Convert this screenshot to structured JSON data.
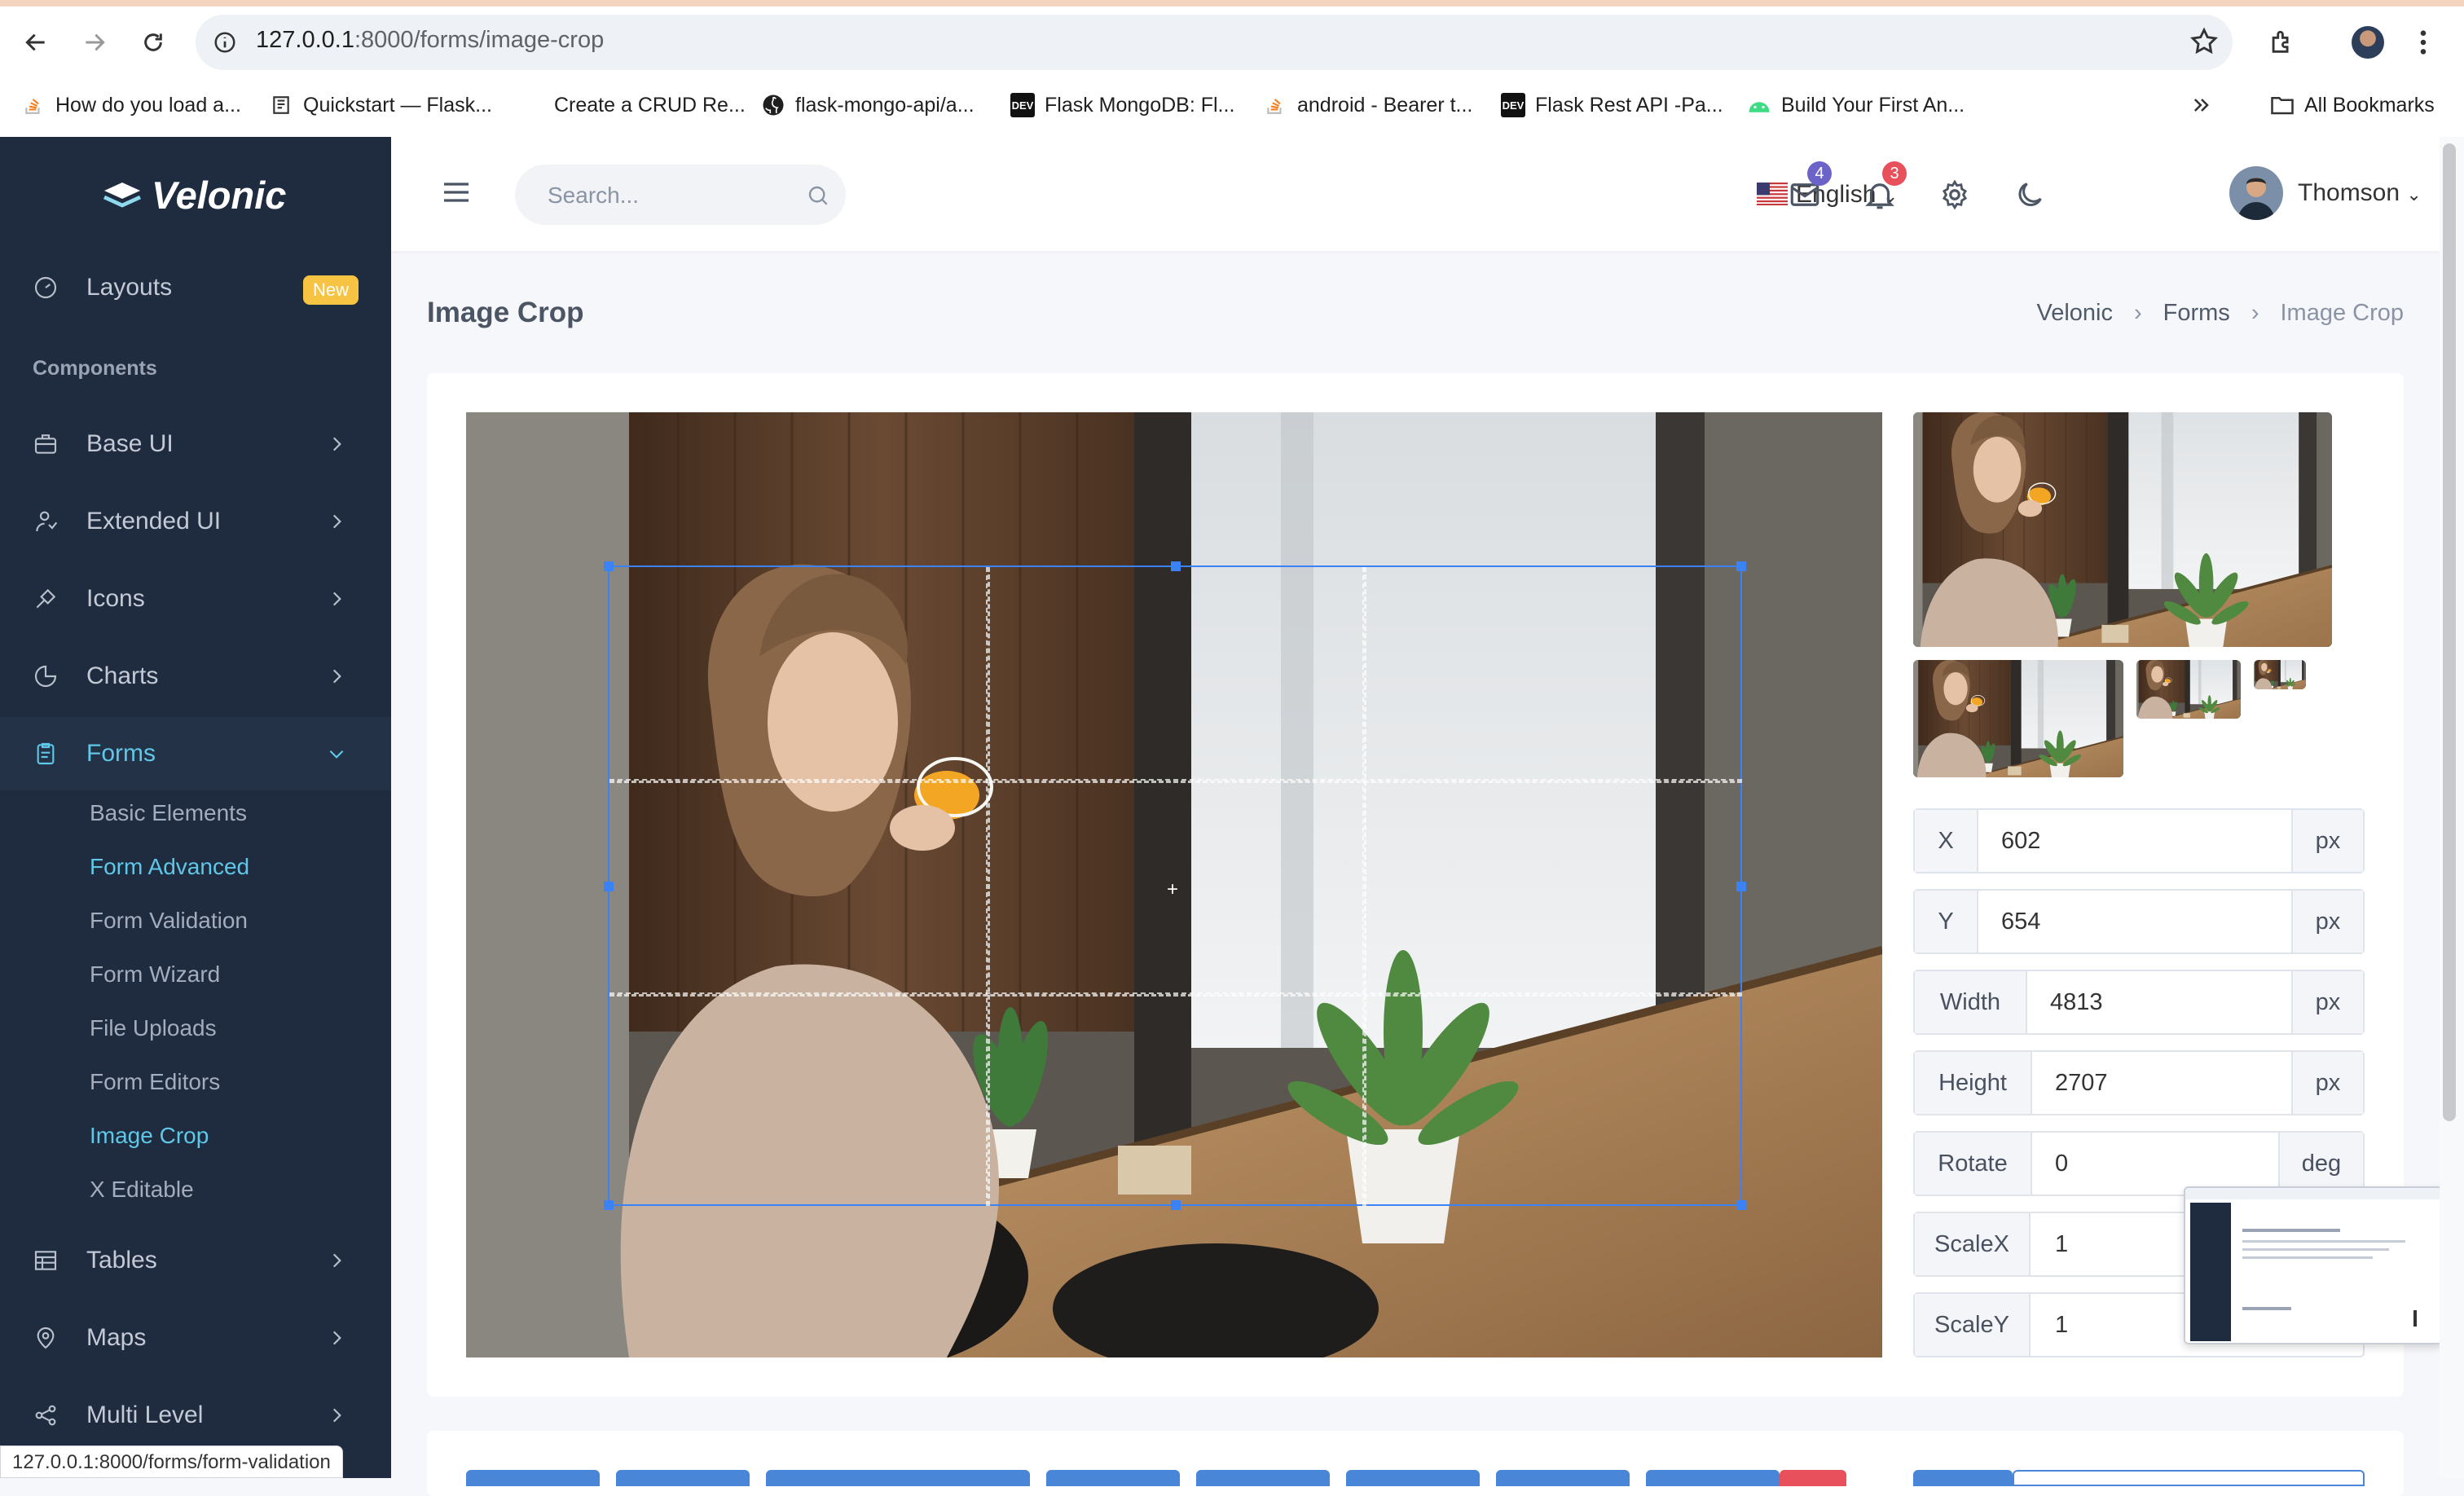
{
  "browser": {
    "url_host": "127.0.0.1",
    "url_path": ":8000/forms/image-crop",
    "bookmarks": [
      "How do you load a...",
      "Quickstart — Flask...",
      "Create a CRUD Re...",
      "flask-mongo-api/a...",
      "Flask MongoDB: Fl...",
      "android - Bearer t...",
      "Flask Rest API -Pa...",
      "Build Your First An..."
    ],
    "all_bookmarks": "All Bookmarks",
    "status_url": "127.0.0.1:8000/forms/form-validation"
  },
  "sidebar": {
    "brand": "Velonic",
    "layouts": "Layouts",
    "new_badge": "New",
    "section": "Components",
    "items": [
      "Base UI",
      "Extended UI",
      "Icons",
      "Charts",
      "Forms"
    ],
    "forms_sub": [
      "Basic Elements",
      "Form Advanced",
      "Form Validation",
      "Form Wizard",
      "File Uploads",
      "Form Editors",
      "Image Crop",
      "X Editable"
    ],
    "more_items": [
      "Tables",
      "Maps",
      "Multi Level"
    ]
  },
  "topbar": {
    "search_placeholder": "Search...",
    "language": "English",
    "mail_count": "4",
    "notif_count": "3",
    "user": "Thomson"
  },
  "page": {
    "title": "Image Crop",
    "breadcrumb": [
      "Velonic",
      "Forms",
      "Image Crop"
    ]
  },
  "crop_fields": [
    {
      "label": "X",
      "value": "602",
      "unit": "px"
    },
    {
      "label": "Y",
      "value": "654",
      "unit": "px"
    },
    {
      "label": "Width",
      "value": "4813",
      "unit": "px"
    },
    {
      "label": "Height",
      "value": "2707",
      "unit": "px"
    },
    {
      "label": "Rotate",
      "value": "0",
      "unit": "deg"
    },
    {
      "label": "ScaleX",
      "value": "1",
      "unit": ""
    },
    {
      "label": "ScaleY",
      "value": "1",
      "unit": ""
    }
  ],
  "colors": {
    "sidebar_bg": "#1f2b3e",
    "accent": "#5fc7e7",
    "crop_border": "#3b82f6",
    "badge_new": "#f7c342",
    "mail_badge": "#6c63c9",
    "notif_badge": "#e8505b"
  }
}
